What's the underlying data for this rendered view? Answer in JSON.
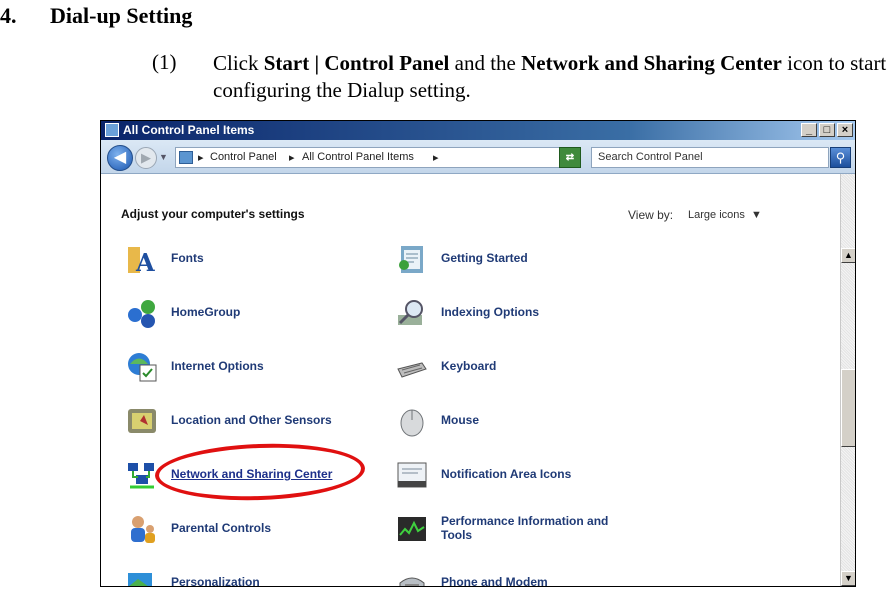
{
  "doc": {
    "heading_number": "4.",
    "heading_text": "Dial-up Setting",
    "step_number": "(1)",
    "step_parts": [
      "Click ",
      "Start | Control Panel",
      " and the ",
      "Network and Sharing Center",
      " icon to start configuring the Dialup setting."
    ]
  },
  "window": {
    "title": "All Control Panel Items",
    "buttons": {
      "minimize": "_",
      "maximize": "□",
      "close": "×"
    },
    "breadcrumb": [
      "Control Panel",
      "All Control Panel Items"
    ],
    "search_placeholder": "Search Control Panel",
    "heading": "Adjust your computer's settings",
    "view_by_label": "View by:",
    "view_by_value": "Large icons",
    "items_left": [
      {
        "label": "Fonts",
        "icon": "fonts-icon"
      },
      {
        "label": "HomeGroup",
        "icon": "homegroup-icon"
      },
      {
        "label": "Internet Options",
        "icon": "internet-options-icon"
      },
      {
        "label": "Location and Other Sensors",
        "icon": "location-sensors-icon"
      },
      {
        "label": "Network and Sharing Center",
        "icon": "network-sharing-icon"
      },
      {
        "label": "Parental Controls",
        "icon": "parental-controls-icon"
      },
      {
        "label": "Personalization",
        "icon": "personalization-icon"
      }
    ],
    "items_right": [
      {
        "label": "Getting Started",
        "icon": "getting-started-icon"
      },
      {
        "label": "Indexing Options",
        "icon": "indexing-options-icon"
      },
      {
        "label": "Keyboard",
        "icon": "keyboard-icon"
      },
      {
        "label": "Mouse",
        "icon": "mouse-icon"
      },
      {
        "label": "Notification Area Icons",
        "icon": "notification-area-icon"
      },
      {
        "label": "Performance Information and Tools",
        "icon": "performance-icon"
      },
      {
        "label": "Phone and Modem",
        "icon": "phone-modem-icon"
      }
    ]
  },
  "colors": {
    "highlight": "#e01010",
    "link": "#1f3a76"
  }
}
